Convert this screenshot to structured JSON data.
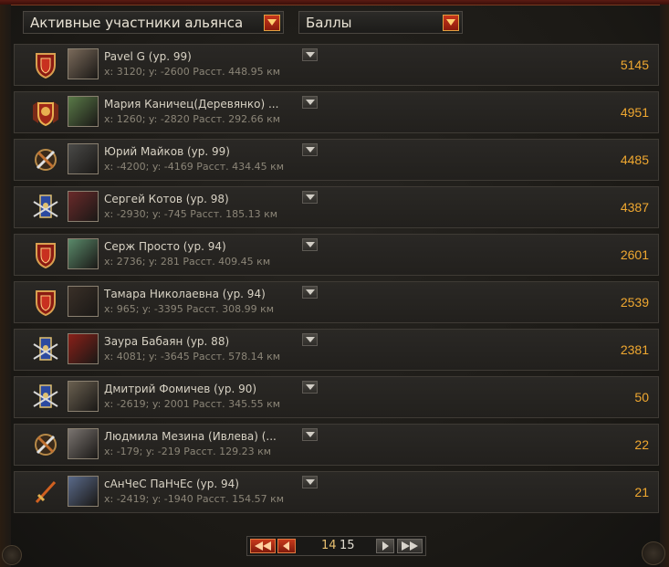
{
  "filters": {
    "members_select": "Активные участники альянса",
    "sort_select": "Баллы"
  },
  "colors": {
    "accent": "#f0a830",
    "dropdown_red": "#c8361c"
  },
  "members": [
    {
      "name": "Pavel G (ур. 99)",
      "coords": "x: 3120; y: -2600 Расст. 448.95 км",
      "score": "5145",
      "rank_icon": "shield-rank-icon"
    },
    {
      "name": "Мария Каничец(Деревянко) ...",
      "coords": "x: 1260; y: -2820 Расст. 292.66 км",
      "score": "4951",
      "rank_icon": "lion-crest-rank-icon"
    },
    {
      "name": "Юрий Майков (ур. 99)",
      "coords": "x: -4200; y: -4169 Расст. 434.45 км",
      "score": "4485",
      "rank_icon": "crossed-swords-rank-icon"
    },
    {
      "name": "Сергей Котов (ур. 98)",
      "coords": "x: -2930; y: -745 Расст. 185.13 км",
      "score": "4387",
      "rank_icon": "banner-swords-rank-icon"
    },
    {
      "name": "Серж Просто (ур. 94)",
      "coords": "x: 2736; y: 281 Расст. 409.45 км",
      "score": "2601",
      "rank_icon": "shield-rank-icon"
    },
    {
      "name": "Тамара Николаевна (ур. 94)",
      "coords": "x: 965; y: -3395 Расст. 308.99 км",
      "score": "2539",
      "rank_icon": "shield-rank-icon"
    },
    {
      "name": "Заура Бабаян (ур. 88)",
      "coords": "x: 4081; y: -3645 Расст. 578.14 км",
      "score": "2381",
      "rank_icon": "banner-swords-rank-icon"
    },
    {
      "name": "Дмитрий Фомичев (ур. 90)",
      "coords": "x: -2619; y: 2001 Расст. 345.55 км",
      "score": "50",
      "rank_icon": "banner-swords-rank-icon"
    },
    {
      "name": "Людмила Мезина (Ивлева) (...",
      "coords": "x: -179; y: -219 Расст. 129.23 км",
      "score": "22",
      "rank_icon": "crossed-swords-rank-icon"
    },
    {
      "name": "сАнЧеС ПаНчЕс (ур. 94)",
      "coords": "x: -2419; y: -1940 Расст. 154.57 км",
      "score": "21",
      "rank_icon": "sword-rank-icon"
    }
  ],
  "pagination": {
    "current_page": "14",
    "next_page": "15"
  }
}
